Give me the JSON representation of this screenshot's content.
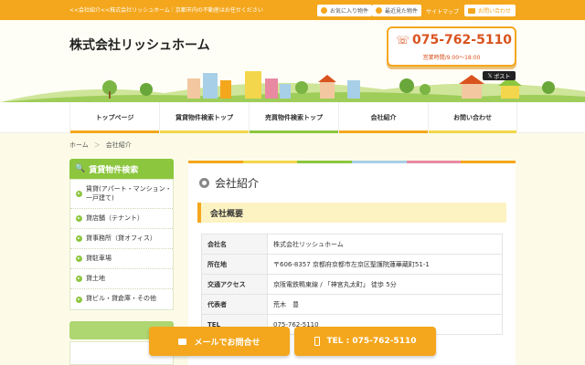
{
  "topbar": {
    "tagline": "<<会社紹介<<株式会社リッシュホーム｜京都市内の不動産はお任せください",
    "favorites": "お気に入り物件",
    "recent": "最近見た物件",
    "sitemap": "サイトマップ",
    "contact": "お問い合わせ"
  },
  "header": {
    "company": "株式会社リッシュホーム",
    "tel": "075-762-5110",
    "hours": "営業時間/9:00～18:00",
    "post": "ポスト"
  },
  "nav": {
    "items": [
      {
        "label": "トップページ",
        "color": "#f4a71d"
      },
      {
        "label": "賃貸物件検索トップ",
        "color": "#f3d64b"
      },
      {
        "label": "売買物件検索トップ",
        "color": "#8cc63f"
      },
      {
        "label": "会社紹介",
        "color": "#f4a71d"
      },
      {
        "label": "お問い合わせ",
        "color": "#f3d64b"
      }
    ]
  },
  "breadcrumb": {
    "home": "ホーム",
    "sep": "＞",
    "current": "会社紹介"
  },
  "sidebar": {
    "title": "賃貸物件検索",
    "items": [
      "賃貸(アパート・マンション・一戸建て)",
      "貸店舗（テナント）",
      "貸事務所（貸オフィス）",
      "貸駐車場",
      "貸土地",
      "貸ビル・貸倉庫・その他"
    ]
  },
  "main": {
    "title": "会社紹介",
    "section": "会社概要",
    "rows": [
      {
        "k": "会社名",
        "v": "株式会社リッシュホーム"
      },
      {
        "k": "所在地",
        "v": "〒606-8357 京都府京都市左京区聖護院蓮華蔵町51-1"
      },
      {
        "k": "交通アクセス",
        "v": "京阪電鉄鴨東線 / 「神宮丸太町」 徒歩 5分"
      },
      {
        "k": "代表者",
        "v": "荒木　豊"
      },
      {
        "k": "TEL",
        "v": "075-762-5110"
      }
    ]
  },
  "cta": {
    "mail": "メールでお問合せ",
    "tel": "TEL : 075-762-5110"
  },
  "colors": {
    "accent": "#f4a71d",
    "green": "#8cc63f",
    "red": "#d9531e"
  }
}
